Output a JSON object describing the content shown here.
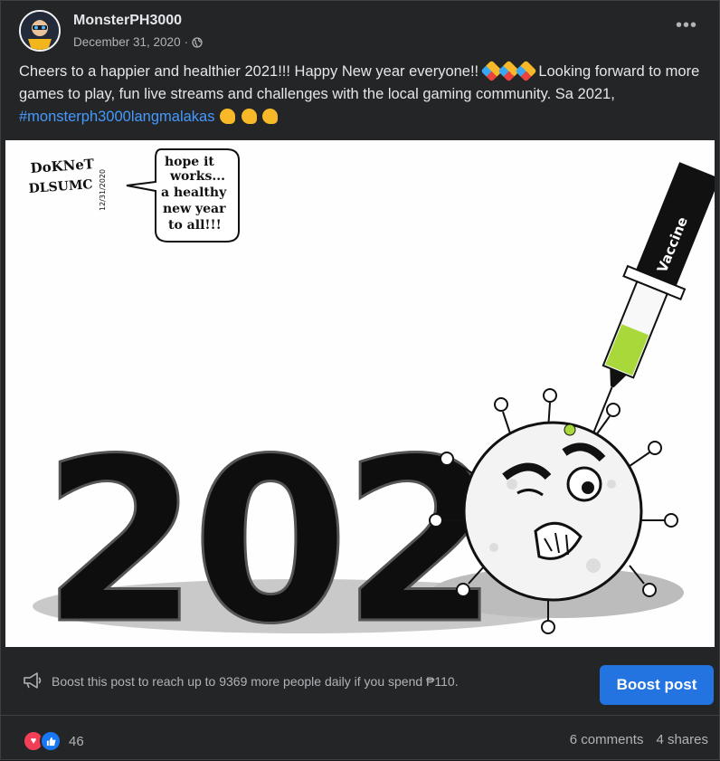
{
  "post": {
    "author": "MonsterPH3000",
    "date": "December 31, 2020",
    "separator": "·",
    "more_label": "•••",
    "text_before_hashtag": "Cheers to a happier and healthier 2021!!! Happy New year everyone!! ",
    "text_middle": " Looking forward to more games to play, fun live streams and challenges with the local gaming community. Sa 2021, ",
    "hashtag": "#monsterph3000langmalakas"
  },
  "image": {
    "signature_line1": "DoKNeT",
    "signature_line2": "DLSUMC",
    "signature_date": "12/31/2020",
    "bubble_lines": [
      "hope it",
      "works...",
      "a healthy",
      "new year",
      "to all!!!"
    ],
    "year_digits": "202",
    "needle_number": "1",
    "needle_label": "Vaccine"
  },
  "boost": {
    "text": "Boost this post to reach up to 9369 more people daily if you spend ",
    "amount": "₱110.",
    "button_label": "Boost post"
  },
  "footer": {
    "reaction_count": "46",
    "comments": "6 comments",
    "shares": "4 shares"
  },
  "colors": {
    "background": "#242526",
    "accent": "#2374e1",
    "hashtag": "#4599ff",
    "love": "#f33e58",
    "like": "#1877f2"
  }
}
